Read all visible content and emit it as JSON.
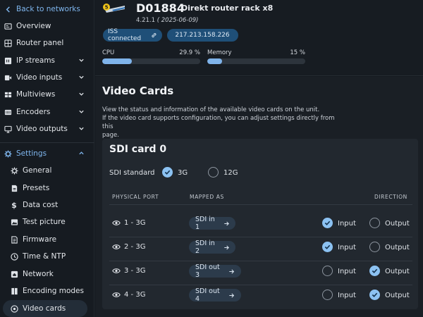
{
  "sidebar": {
    "back_label": "Back to networks",
    "items": [
      {
        "label": "Overview",
        "icon": "overview-icon"
      },
      {
        "label": "Router panel",
        "icon": "router-panel-icon"
      },
      {
        "label": "IP streams",
        "icon": "ip-streams-icon"
      },
      {
        "label": "Video inputs",
        "icon": "video-inputs-icon"
      },
      {
        "label": "Multiviews",
        "icon": "multiviews-icon"
      },
      {
        "label": "Encoders",
        "icon": "encoders-icon"
      },
      {
        "label": "Video outputs",
        "icon": "video-outputs-icon"
      }
    ],
    "settings_label": "Settings",
    "settings_items": [
      {
        "label": "General",
        "icon": "gear-icon"
      },
      {
        "label": "Presets",
        "icon": "presets-icon"
      },
      {
        "label": "Data cost",
        "icon": "dollar-icon"
      },
      {
        "label": "Test picture",
        "icon": "image-icon"
      },
      {
        "label": "Firmware",
        "icon": "firmware-icon"
      },
      {
        "label": "Time & NTP",
        "icon": "clock-icon"
      },
      {
        "label": "Network",
        "icon": "network-icon"
      },
      {
        "label": "Encoding modes",
        "icon": "encoding-modes-icon"
      },
      {
        "label": "Video cards",
        "icon": "video-cards-icon"
      }
    ]
  },
  "device": {
    "id": "D01884",
    "name": "Direkt router rack x8",
    "version": "4.21.1",
    "build_date": "( 2025-06-09)",
    "iss_chip": "ISS connected",
    "ip_chip": "217.213.158.226",
    "cpu_label": "CPU",
    "cpu_value": "29.9 %",
    "cpu_percent": 29.9,
    "memory_label": "Memory",
    "memory_value": "15 %",
    "memory_percent": 15
  },
  "page": {
    "title": "Video Cards",
    "description_1": "View the status and information of the available video cards on the unit.",
    "description_2": "If the video card supports configuration, you can adjust settings directly from this",
    "description_3": "page."
  },
  "card": {
    "title": "SDI card 0",
    "standard_label": "SDI standard",
    "standard_options": [
      "3G",
      "12G"
    ],
    "standard_selected": "3G",
    "headers": {
      "port": "PHYSICAL PORT",
      "mapped": "MAPPED AS",
      "direction": "DIRECTION"
    },
    "input_label": "Input",
    "output_label": "Output",
    "rows": [
      {
        "port": "1 - 3G",
        "mapped": "SDI in 1",
        "direction": "Input"
      },
      {
        "port": "2 - 3G",
        "mapped": "SDI in 2",
        "direction": "Input"
      },
      {
        "port": "3 - 3G",
        "mapped": "SDI out 3",
        "direction": "Output"
      },
      {
        "port": "4 - 3G",
        "mapped": "SDI out 4",
        "direction": "Output"
      }
    ]
  },
  "colors": {
    "accent": "#7fb3ea",
    "chip": "#1f4f78",
    "radio_selected": "#8cc2f2",
    "background": "#14191f"
  }
}
